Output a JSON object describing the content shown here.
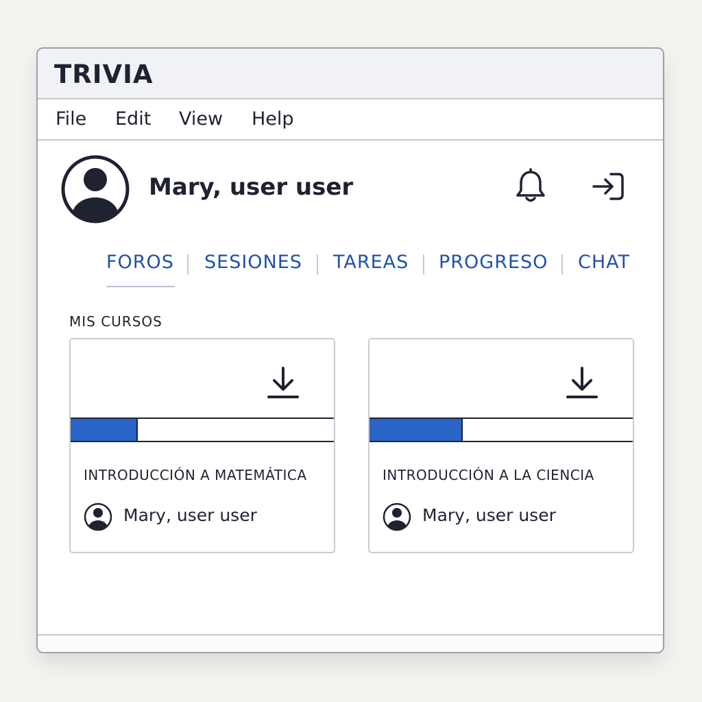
{
  "app": {
    "title": "TRIVIA"
  },
  "menu": {
    "items": [
      "File",
      "Edit",
      "View",
      "Help"
    ]
  },
  "header": {
    "user_name": "Mary, user user",
    "avatar_icon": "user-avatar-icon",
    "notification_icon": "bell-icon",
    "logout_icon": "sign-out-icon"
  },
  "tabs": {
    "items": [
      "FOROS",
      "SESIONES",
      "TAREAS",
      "PROGRESO",
      "CHAT"
    ],
    "active": "FOROS"
  },
  "courses": {
    "section_label": "MIS CURSOS",
    "items": [
      {
        "title": "INTRODUCCIÓN A MATEMÁTICA",
        "owner": "Mary, user user",
        "progress": 0.25,
        "action_icon": "download-icon"
      },
      {
        "title": "INTRODUCCIÓN A LA CIENCIA",
        "owner": "Mary, user user",
        "progress": 0.35,
        "action_icon": "download-icon"
      }
    ]
  },
  "colors": {
    "accent": "#1f52a8",
    "progress": "#2a64c6",
    "text": "#1f2230",
    "border": "#c9ccd5"
  }
}
